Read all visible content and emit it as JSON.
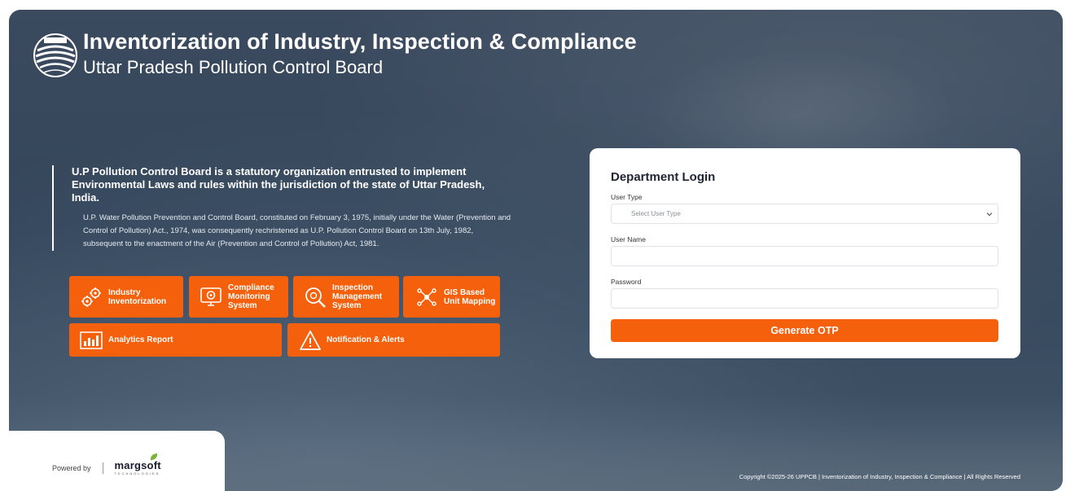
{
  "header": {
    "title": "Inventorization of Industry, Inspection & Compliance",
    "subtitle": "Uttar Pradesh Pollution Control Board",
    "logo_icon": "uppcb-emblem-icon"
  },
  "about": {
    "heading": "U.P Pollution Control Board is a statutory organization entrusted to implement Environmental Laws and rules within the jurisdiction of the state of Uttar Pradesh, India.",
    "body": "U.P. Water Pollution Prevention and Control Board, constituted on February 3, 1975, initially under the Water (Prevention and Control of Pollution) Act., 1974, was consequently rechristened as U.P. Pollution Control Board on 13th July, 1982, subsequent to the enactment of the Air (Prevention and Control of Pollution) Act, 1981."
  },
  "tiles": [
    {
      "label": "Industry Inventorization",
      "icon": "gears-icon"
    },
    {
      "label": "Compliance Monitoring System",
      "icon": "monitor-gear-icon"
    },
    {
      "label": "Inspection Management System",
      "icon": "magnifier-gear-icon"
    },
    {
      "label": "GIS Based Unit Mapping",
      "icon": "network-map-icon"
    },
    {
      "label": "Analytics Report",
      "icon": "bar-chart-icon"
    },
    {
      "label": "Notification & Alerts",
      "icon": "warning-icon"
    }
  ],
  "login": {
    "title": "Department Login",
    "user_type_label": "User Type",
    "user_type_selected": "Select User Type",
    "username_label": "User Name",
    "username_value": "",
    "password_label": "Password",
    "password_value": "",
    "submit_label": "Generate OTP"
  },
  "powered": {
    "label": "Powered by",
    "brand_name": "margsoft",
    "brand_sub": "TECHNOLOGIES"
  },
  "footer": {
    "copyright": "Copyright ©2025-26 UPPCB | Inventorization of Industry, Inspection & Compliance | All Rights Reserved"
  },
  "colors": {
    "accent": "#f4600c",
    "hero_bg": "#3b4a5e",
    "card": "#ffffff"
  }
}
